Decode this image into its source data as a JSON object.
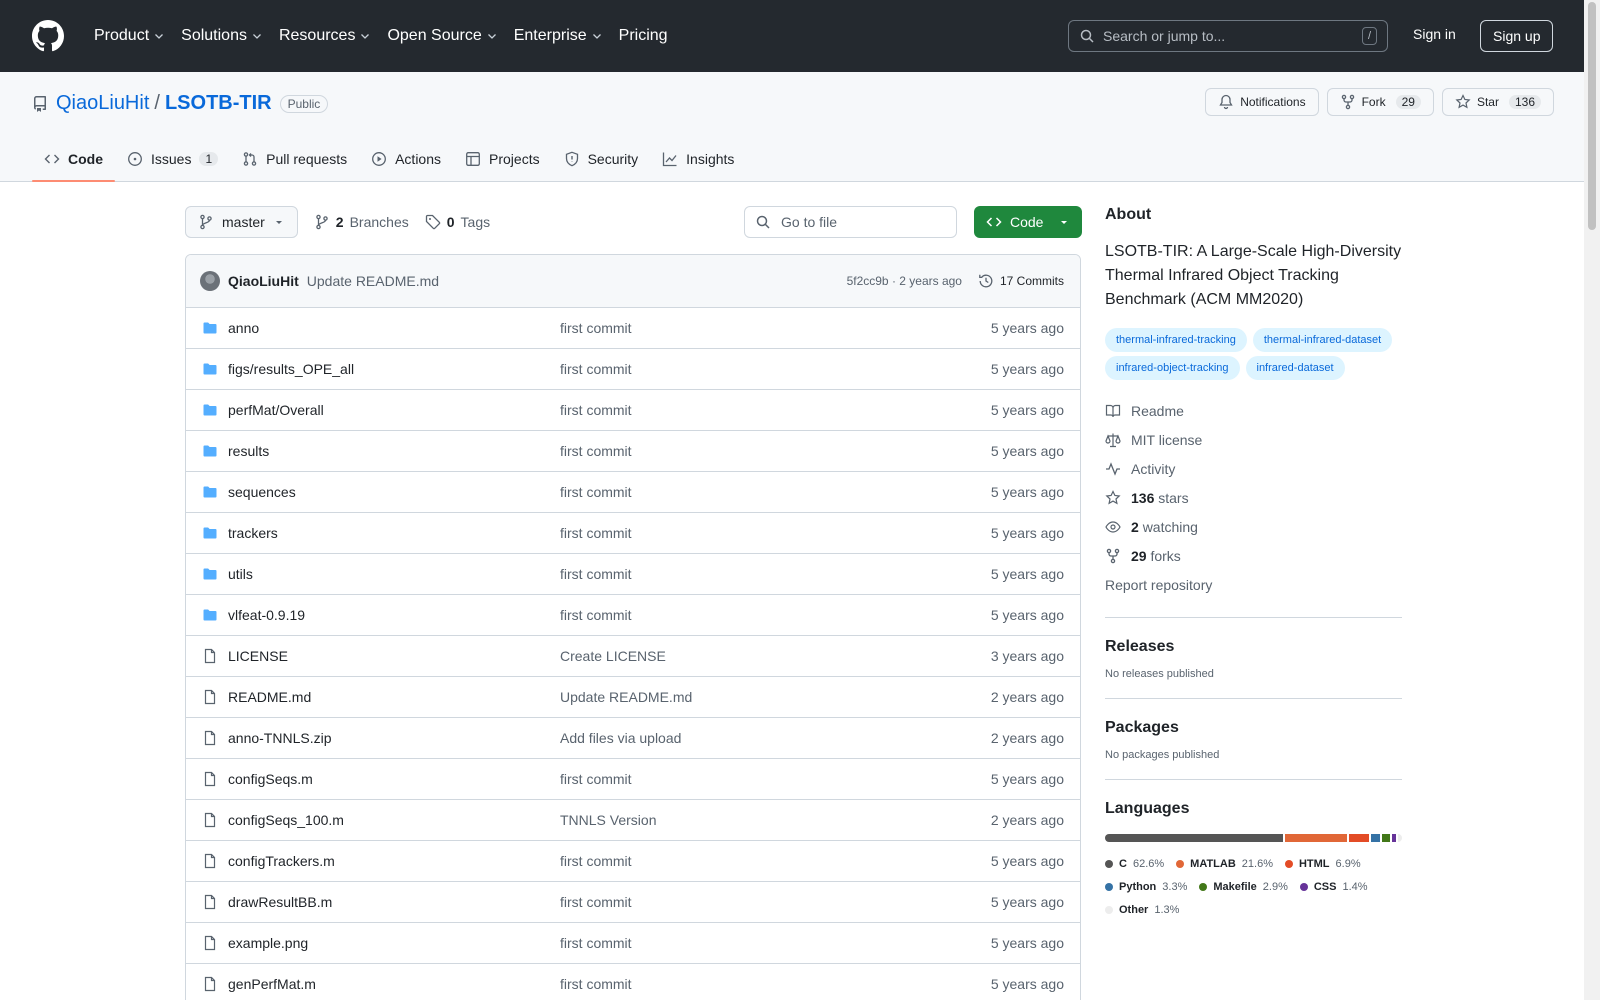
{
  "header": {
    "nav": [
      "Product",
      "Solutions",
      "Resources",
      "Open Source",
      "Enterprise",
      "Pricing"
    ],
    "search_placeholder": "Search or jump to...",
    "search_shortcut": "/",
    "signin": "Sign in",
    "signup": "Sign up"
  },
  "repo": {
    "owner": "QiaoLiuHit",
    "separator": "/",
    "name": "LSOTB-TIR",
    "visibility": "Public",
    "notifications": "Notifications",
    "fork_label": "Fork",
    "fork_count": "29",
    "star_label": "Star",
    "star_count": "136"
  },
  "tabs": [
    {
      "label": "Code"
    },
    {
      "label": "Issues",
      "count": "1"
    },
    {
      "label": "Pull requests"
    },
    {
      "label": "Actions"
    },
    {
      "label": "Projects"
    },
    {
      "label": "Security"
    },
    {
      "label": "Insights"
    }
  ],
  "toolbar": {
    "branch": "master",
    "branches_count": "2",
    "branches_label": "Branches",
    "tags_count": "0",
    "tags_label": "Tags",
    "goto_placeholder": "Go to file",
    "code_button": "Code"
  },
  "latest_commit": {
    "author": "QiaoLiuHit",
    "message": "Update README.md",
    "sha_time": "5f2cc9b · 2 years ago",
    "commits": "17 Commits"
  },
  "files": [
    {
      "type": "dir",
      "name": "anno",
      "message": "first commit",
      "date": "5 years ago"
    },
    {
      "type": "dir",
      "name": "figs/results_OPE_all",
      "message": "first commit",
      "date": "5 years ago"
    },
    {
      "type": "dir",
      "name": "perfMat/Overall",
      "message": "first commit",
      "date": "5 years ago"
    },
    {
      "type": "dir",
      "name": "results",
      "message": "first commit",
      "date": "5 years ago"
    },
    {
      "type": "dir",
      "name": "sequences",
      "message": "first commit",
      "date": "5 years ago"
    },
    {
      "type": "dir",
      "name": "trackers",
      "message": "first commit",
      "date": "5 years ago"
    },
    {
      "type": "dir",
      "name": "utils",
      "message": "first commit",
      "date": "5 years ago"
    },
    {
      "type": "dir",
      "name": "vlfeat-0.9.19",
      "message": "first commit",
      "date": "5 years ago"
    },
    {
      "type": "file",
      "name": "LICENSE",
      "message": "Create LICENSE",
      "date": "3 years ago"
    },
    {
      "type": "file",
      "name": "README.md",
      "message": "Update README.md",
      "date": "2 years ago"
    },
    {
      "type": "file",
      "name": "anno-TNNLS.zip",
      "message": "Add files via upload",
      "date": "2 years ago"
    },
    {
      "type": "file",
      "name": "configSeqs.m",
      "message": "first commit",
      "date": "5 years ago"
    },
    {
      "type": "file",
      "name": "configSeqs_100.m",
      "message": "TNNLS Version",
      "date": "2 years ago"
    },
    {
      "type": "file",
      "name": "configTrackers.m",
      "message": "first commit",
      "date": "5 years ago"
    },
    {
      "type": "file",
      "name": "drawResultBB.m",
      "message": "first commit",
      "date": "5 years ago"
    },
    {
      "type": "file",
      "name": "example.png",
      "message": "first commit",
      "date": "5 years ago"
    },
    {
      "type": "file",
      "name": "genPerfMat.m",
      "message": "first commit",
      "date": "5 years ago"
    }
  ],
  "about": {
    "title": "About",
    "description": "LSOTB-TIR: A Large-Scale High-Diversity Thermal Infrared Object Tracking Benchmark (ACM MM2020)",
    "topics": [
      "thermal-infrared-tracking",
      "thermal-infrared-dataset",
      "infrared-object-tracking",
      "infrared-dataset"
    ],
    "links": [
      {
        "icon": "book-icon",
        "label": "Readme"
      },
      {
        "icon": "law-icon",
        "label": "MIT license"
      },
      {
        "icon": "pulse-icon",
        "label": "Activity"
      },
      {
        "icon": "star-icon",
        "count": "136",
        "label": "stars"
      },
      {
        "icon": "eye-icon",
        "count": "2",
        "label": "watching"
      },
      {
        "icon": "fork-icon",
        "count": "29",
        "label": "forks"
      }
    ],
    "report": "Report repository"
  },
  "releases": {
    "title": "Releases",
    "note": "No releases published"
  },
  "packages": {
    "title": "Packages",
    "note": "No packages published"
  },
  "languages": {
    "title": "Languages",
    "items": [
      {
        "name": "C",
        "percent": "62.6%",
        "value": 62.6,
        "color": "#555555"
      },
      {
        "name": "MATLAB",
        "percent": "21.6%",
        "value": 21.6,
        "color": "#e16737"
      },
      {
        "name": "HTML",
        "percent": "6.9%",
        "value": 6.9,
        "color": "#e34c26"
      },
      {
        "name": "Python",
        "percent": "3.3%",
        "value": 3.3,
        "color": "#3572A5"
      },
      {
        "name": "Makefile",
        "percent": "2.9%",
        "value": 2.9,
        "color": "#427819"
      },
      {
        "name": "CSS",
        "percent": "1.4%",
        "value": 1.4,
        "color": "#663399"
      },
      {
        "name": "Other",
        "percent": "1.3%",
        "value": 1.3,
        "color": "#ededed"
      }
    ]
  }
}
